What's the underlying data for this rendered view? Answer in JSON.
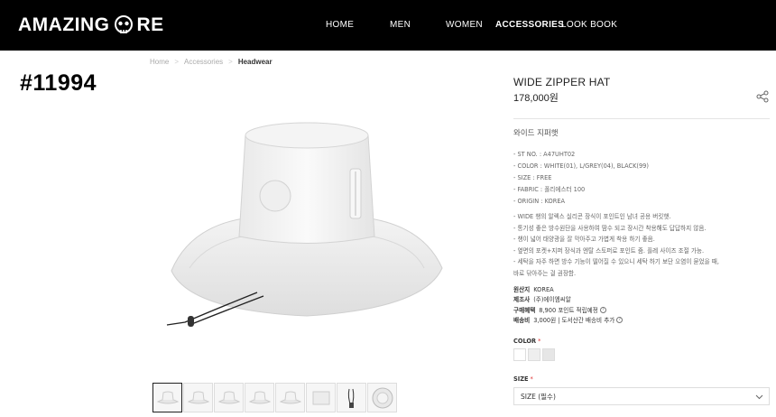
{
  "header": {
    "logo_left": "AMAZING",
    "logo_right": "RE",
    "nav": [
      "HOME",
      "MEN",
      "WOMEN",
      "ACCESSORIES",
      "LOOK BOOK"
    ],
    "active_nav": "ACCESSORIES"
  },
  "breadcrumb": [
    "Home",
    "Accessories",
    "Headwear"
  ],
  "overlay_id": "#11994",
  "product": {
    "title": "WIDE ZIPPER HAT",
    "price": "178,000원",
    "korean_name": "와이드 지퍼햇",
    "specs": [
      "- ST NO. : A47UHT02",
      "- COLOR : WHITE(01), L/GREY(04), BLACK(99)",
      "- SIZE : FREE",
      "- FABRIC : 폴리에스터 100",
      "- ORIGIN : KOREA"
    ],
    "description": [
      "- WIDE 챙의 알렉스 실리콘 장식이 포인트인 남녀 공용 버킷햇.",
      "- 통기성 좋은 방수원단을 사용하여 땀수 되고 장시간 착용해도 답답하지 않음.",
      "- 챙이 넓어 태양광을 잘 막아주고 가볍게 착용 하기 좋음.",
      "- 옆면의 포켓+지퍼 장식과 엔탈 스토퍼로 포인트 줌. 플레 사이즈 조절 가능.",
      "- 세탁을 자주 하면 방수 기능이 떨어질 수 있으니 세탁 하기 보단 오염이 묻었을 때,",
      "   바로 닦아주는 걸 권장함."
    ],
    "info": [
      {
        "key": "원산지",
        "value": "KOREA",
        "help": false
      },
      {
        "key": "제조사",
        "value": "(주)에이엠씨알",
        "help": false
      },
      {
        "key": "구매혜택",
        "value": "8,900 포인트 적립예정",
        "help": true
      },
      {
        "key": "배송비",
        "value": "3,000원  |  도서산간 배송비 추가",
        "help": true
      }
    ],
    "color_label": "COLOR",
    "size_label": "SIZE",
    "required_mark": "*",
    "swatch_colors": [
      "#ffffff",
      "#eeeeee",
      "#e6e6e6"
    ],
    "size_select": "SIZE (필수)"
  },
  "thumbnails_count": 8,
  "icons": {
    "share": "share-icon",
    "skull": "skull-icon",
    "chevron": "chevron-down-icon"
  }
}
